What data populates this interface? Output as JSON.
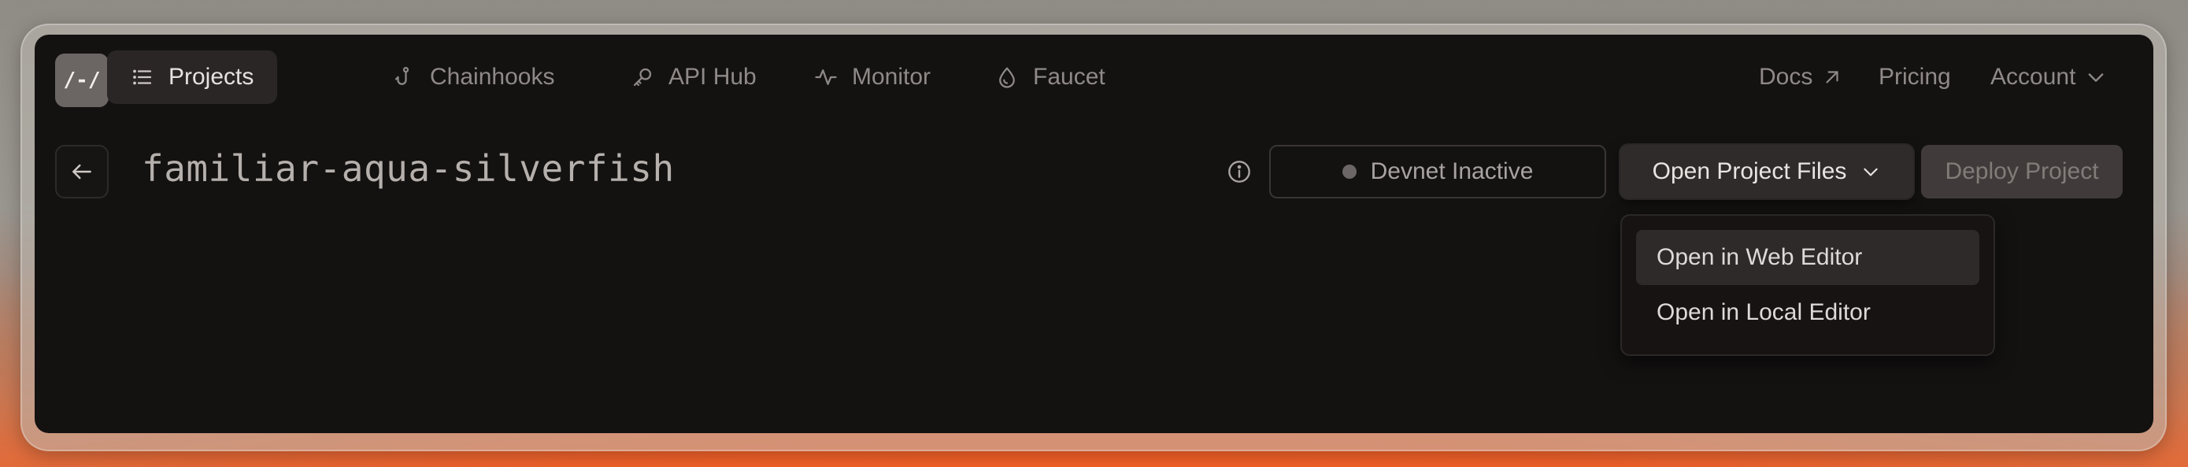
{
  "nav": {
    "logo_text": "/-/",
    "items": [
      {
        "label": "Projects",
        "icon": "list-icon",
        "active": true
      },
      {
        "label": "Chainhooks",
        "icon": "hook-icon",
        "active": false
      },
      {
        "label": "API Hub",
        "icon": "key-icon",
        "active": false
      },
      {
        "label": "Monitor",
        "icon": "activity-icon",
        "active": false
      },
      {
        "label": "Faucet",
        "icon": "droplet-icon",
        "active": false
      }
    ],
    "right": {
      "docs": "Docs",
      "pricing": "Pricing",
      "account": "Account"
    }
  },
  "project": {
    "name": "familiar-aqua-silverfish",
    "devnet_status": "Devnet Inactive",
    "open_files_label": "Open Project Files",
    "deploy_label": "Deploy Project"
  },
  "dropdown": {
    "items": [
      "Open in Web Editor",
      "Open in Local Editor"
    ]
  },
  "colors": {
    "window_bg": "#141111",
    "active_nav_bg": "#2a2626",
    "accent_bottom": "#ff5a1a"
  }
}
